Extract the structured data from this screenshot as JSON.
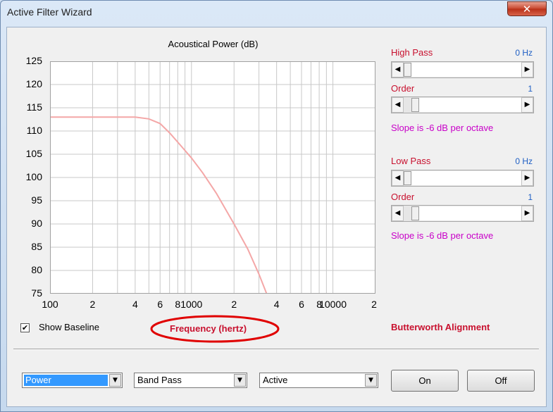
{
  "window": {
    "title": "Active Filter Wizard",
    "close_glyph": "✕"
  },
  "chart_data": {
    "type": "line",
    "title": "Acoustical Power (dB)",
    "xlabel": "Frequency (hertz)",
    "ylabel": "",
    "x_scale": "log",
    "xlim": [
      100,
      20000
    ],
    "ylim": [
      75,
      125
    ],
    "y_ticks": [
      "125",
      "120",
      "115",
      "110",
      "105",
      "100",
      "95",
      "90",
      "85",
      "80",
      "75"
    ],
    "x_ticks": [
      {
        "value": 100,
        "label": "100"
      },
      {
        "value": 200,
        "label": "2"
      },
      {
        "value": 400,
        "label": "4"
      },
      {
        "value": 600,
        "label": "6"
      },
      {
        "value": 800,
        "label": "8"
      },
      {
        "value": 1000,
        "label": "1000"
      },
      {
        "value": 2000,
        "label": "2"
      },
      {
        "value": 4000,
        "label": "4"
      },
      {
        "value": 6000,
        "label": "6"
      },
      {
        "value": 8000,
        "label": "8"
      },
      {
        "value": 10000,
        "label": "10000"
      },
      {
        "value": 20000,
        "label": "2"
      }
    ],
    "grid": true,
    "series_color": "#f4a7a7",
    "x": [
      100,
      200,
      300,
      400,
      500,
      600,
      700,
      800,
      1000,
      1200,
      1500,
      2000,
      2500,
      3000,
      3400
    ],
    "y": [
      113,
      113,
      113,
      113,
      112.6,
      111.6,
      109.6,
      107.6,
      104.2,
      101.0,
      96.6,
      90.0,
      84.6,
      79.2,
      75
    ]
  },
  "filters": {
    "high_pass": {
      "label": "High Pass",
      "value": "0 Hz",
      "order_label": "Order",
      "order_value": "1",
      "slope_text": "Slope is -6 dB per octave"
    },
    "low_pass": {
      "label": "Low Pass",
      "value": "0 Hz",
      "order_label": "Order",
      "order_value": "1",
      "slope_text": "Slope is -6 dB per octave"
    },
    "alignment": "Butterworth Alignment"
  },
  "baseline": {
    "label": "Show Baseline",
    "checked": true,
    "check_glyph": "✔"
  },
  "controls": {
    "mode": "Power",
    "filter_type": "Band Pass",
    "filter_kind": "Active",
    "on_label": "On",
    "off_label": "Off"
  },
  "annotation": {
    "color": "#e00000"
  },
  "glyphs": {
    "left_arrow": "◀",
    "right_arrow": "▶",
    "down_arrow": "▼"
  }
}
